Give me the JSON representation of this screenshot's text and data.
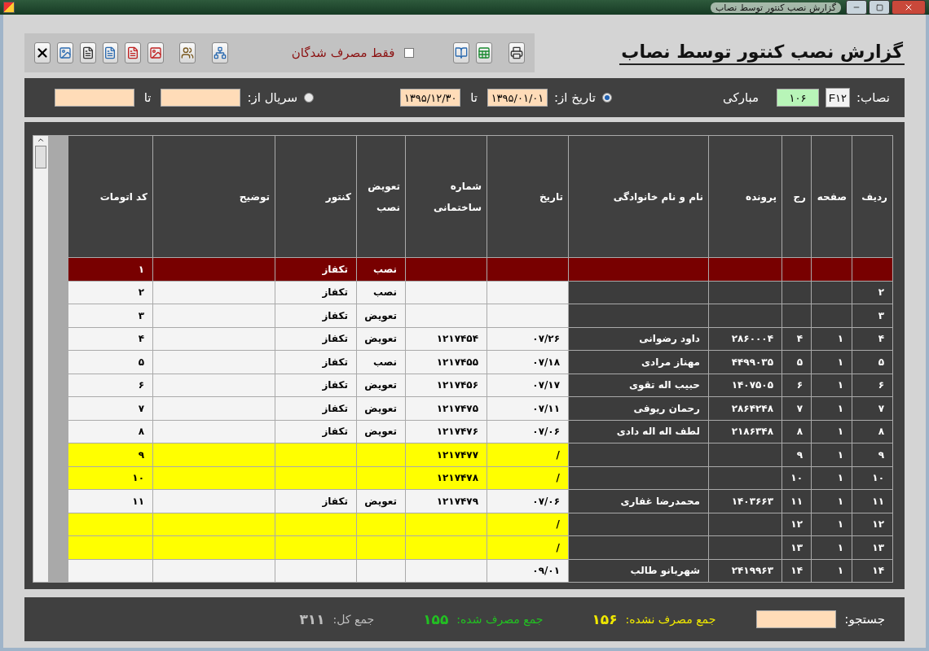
{
  "window": {
    "title": "گزارش نصب کنتور توسط نصاب"
  },
  "toolbar": {
    "report_title": "گزارش نصب کنتور توسط نصاب",
    "only_consumed": {
      "label": "فقط مصرف شدگان",
      "checked": false
    }
  },
  "filters": {
    "installer_label": "نصاب:",
    "installer_key": "F۱۲",
    "installer_code": "۱۰۶",
    "installer_name": "مبارکی",
    "modes": [
      {
        "label": "تاریخ از:",
        "selected": true,
        "from": "۱۳۹۵/۰۱/۰۱",
        "to_label": "تا",
        "to": "۱۳۹۵/۱۲/۳۰"
      },
      {
        "label": "سریال از:",
        "selected": false,
        "to_label": "تا"
      }
    ]
  },
  "table": {
    "columns": [
      "ردیف",
      "صفحه",
      "رج",
      "پرونده",
      "نام و نام خانوادگی",
      "تاریخ",
      "شماره ساختمانی",
      "تعویض نصب",
      "کنتور",
      "توضیح",
      "کد اتومات"
    ],
    "rows": [
      {
        "selected": true,
        "highlight": false,
        "replace_install": "نصب",
        "meter": "تکفاز",
        "auto_code": "۱"
      },
      {
        "selected": false,
        "highlight": false,
        "row": "۲",
        "replace_install": "نصب",
        "meter": "تکفاز",
        "auto_code": "۲"
      },
      {
        "selected": false,
        "highlight": false,
        "row": "۳",
        "replace_install": "تعویض",
        "meter": "تکفاز",
        "auto_code": "۳"
      },
      {
        "selected": false,
        "highlight": false,
        "row": "۴",
        "page": "۱",
        "line": "۴",
        "file": "۲۸۶۰۰۰۴",
        "name": "داود رضوانی",
        "date": "۰۷/۲۶",
        "building_no": "۱۲۱۷۴۵۴",
        "replace_install": "تعویض",
        "meter": "تکفاز",
        "auto_code": "۴"
      },
      {
        "selected": false,
        "highlight": false,
        "row": "۵",
        "page": "۱",
        "line": "۵",
        "file": "۴۴۹۹۰۳۵",
        "name": "مهناز مرادی",
        "date": "۰۷/۱۸",
        "building_no": "۱۲۱۷۴۵۵",
        "replace_install": "نصب",
        "meter": "تکفاز",
        "auto_code": "۵"
      },
      {
        "selected": false,
        "highlight": false,
        "row": "۶",
        "page": "۱",
        "line": "۶",
        "file": "۱۴۰۷۵۰۵",
        "name": "حبیب اله تقوی",
        "date": "۰۷/۱۷",
        "building_no": "۱۲۱۷۴۵۶",
        "replace_install": "تعویض",
        "meter": "تکفاز",
        "auto_code": "۶"
      },
      {
        "selected": false,
        "highlight": false,
        "row": "۷",
        "page": "۱",
        "line": "۷",
        "file": "۲۸۶۴۲۴۸",
        "name": "رحمان ریوفی",
        "date": "۰۷/۱۱",
        "building_no": "۱۲۱۷۴۷۵",
        "replace_install": "تعویض",
        "meter": "تکفاز",
        "auto_code": "۷"
      },
      {
        "selected": false,
        "highlight": false,
        "row": "۸",
        "page": "۱",
        "line": "۸",
        "file": "۲۱۸۶۳۴۸",
        "name": "لطف اله اله دادی",
        "date": "۰۷/۰۶",
        "building_no": "۱۲۱۷۴۷۶",
        "replace_install": "تعویض",
        "meter": "تکفاز",
        "auto_code": "۸"
      },
      {
        "selected": false,
        "highlight": true,
        "row": "۹",
        "page": "۱",
        "line": "۹",
        "date": "/",
        "building_no": "۱۲۱۷۴۷۷",
        "auto_code": "۹"
      },
      {
        "selected": false,
        "highlight": true,
        "row": "۱۰",
        "page": "۱",
        "line": "۱۰",
        "date": "/",
        "building_no": "۱۲۱۷۴۷۸",
        "auto_code": "۱۰"
      },
      {
        "selected": false,
        "highlight": false,
        "row": "۱۱",
        "page": "۱",
        "line": "۱۱",
        "file": "۱۴۰۳۶۶۳",
        "name": "محمدرضا غفاری",
        "date": "۰۷/۰۶",
        "building_no": "۱۲۱۷۴۷۹",
        "replace_install": "تعویض",
        "meter": "تکفاز",
        "auto_code": "۱۱"
      },
      {
        "selected": false,
        "highlight": true,
        "row": "۱۲",
        "page": "۱",
        "line": "۱۲",
        "date": "/"
      },
      {
        "selected": false,
        "highlight": true,
        "row": "۱۳",
        "page": "۱",
        "line": "۱۳",
        "date": "/"
      },
      {
        "selected": false,
        "highlight": false,
        "row": "۱۴",
        "page": "۱",
        "line": "۱۴",
        "file": "۲۴۱۹۹۶۳",
        "name": "شهربانو طالب",
        "date": "۰۹/۰۱"
      }
    ]
  },
  "footer": {
    "search_label": "جستجو:",
    "totals": [
      {
        "kind": "unconsumed",
        "label": "جمع مصرف نشده:",
        "value": "۱۵۶"
      },
      {
        "kind": "consumed",
        "label": "جمع مصرف شده:",
        "value": "۱۵۵"
      },
      {
        "kind": "total",
        "label": "جمع کل:",
        "value": "۳۱۱"
      }
    ]
  }
}
